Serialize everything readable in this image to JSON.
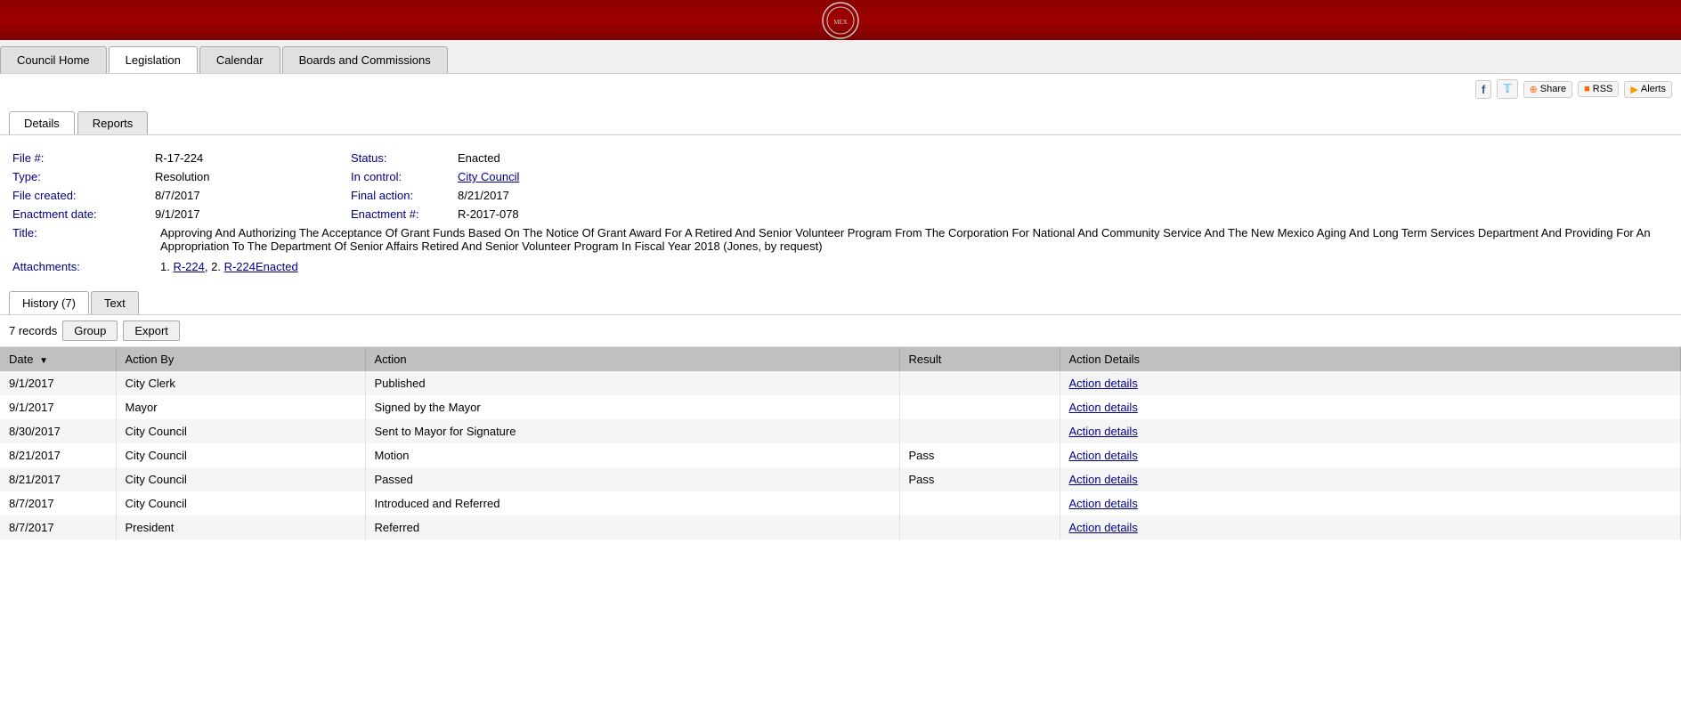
{
  "header": {
    "banner_alt": "City Seal"
  },
  "nav": {
    "tabs": [
      {
        "label": "Council Home",
        "active": false
      },
      {
        "label": "Legislation",
        "active": true
      },
      {
        "label": "Calendar",
        "active": false
      },
      {
        "label": "Boards and Commissions",
        "active": false
      }
    ]
  },
  "social": {
    "share_label": "Share",
    "rss_label": "RSS",
    "alerts_label": "Alerts"
  },
  "content_tabs": [
    {
      "label": "Details",
      "active": true
    },
    {
      "label": "Reports",
      "active": false
    }
  ],
  "details": {
    "file_label": "File #:",
    "file_value": "R-17-224",
    "type_label": "Type:",
    "type_value": "Resolution",
    "status_label": "Status:",
    "status_value": "Enacted",
    "file_created_label": "File created:",
    "file_created_value": "8/7/2017",
    "in_control_label": "In control:",
    "in_control_value": "City Council",
    "final_action_label": "Final action:",
    "final_action_value": "8/21/2017",
    "enactment_date_label": "Enactment date:",
    "enactment_date_value": "9/1/2017",
    "enactment_num_label": "Enactment #:",
    "enactment_num_value": "R-2017-078",
    "title_label": "Title:",
    "title_value": "Approving And Authorizing The Acceptance Of Grant Funds Based On The Notice Of Grant Award For A Retired And Senior Volunteer Program From The Corporation For National And Community Service And The New Mexico Aging And Long Term Services Department And Providing For An Appropriation To The Department Of Senior Affairs Retired And Senior Volunteer Program In Fiscal Year 2018 (Jones, by request)",
    "attachments_label": "Attachments:",
    "attachments": [
      {
        "num": "1.",
        "label": "R-224",
        "sep": ", 2."
      },
      {
        "num": "2.",
        "label": "R-224Enacted",
        "sep": ""
      }
    ]
  },
  "history": {
    "tabs": [
      {
        "label": "History (7)",
        "active": true
      },
      {
        "label": "Text",
        "active": false
      }
    ],
    "records_label": "7 records",
    "buttons": [
      "Group",
      "Export"
    ],
    "columns": [
      "Date",
      "Action By",
      "Action",
      "Result",
      "Action Details"
    ],
    "rows": [
      {
        "date": "9/1/2017",
        "action_by": "City Clerk",
        "action": "Published",
        "result": "",
        "action_details": "Action details"
      },
      {
        "date": "9/1/2017",
        "action_by": "Mayor",
        "action": "Signed by the Mayor",
        "result": "",
        "action_details": "Action details"
      },
      {
        "date": "8/30/2017",
        "action_by": "City Council",
        "action": "Sent to Mayor for Signature",
        "result": "",
        "action_details": "Action details"
      },
      {
        "date": "8/21/2017",
        "action_by": "City Council",
        "action": "Motion",
        "result": "Pass",
        "action_details": "Action details"
      },
      {
        "date": "8/21/2017",
        "action_by": "City Council",
        "action": "Passed",
        "result": "Pass",
        "action_details": "Action details"
      },
      {
        "date": "8/7/2017",
        "action_by": "City Council",
        "action": "Introduced and Referred",
        "result": "",
        "action_details": "Action details"
      },
      {
        "date": "8/7/2017",
        "action_by": "President",
        "action": "Referred",
        "result": "",
        "action_details": "Action details"
      }
    ]
  }
}
